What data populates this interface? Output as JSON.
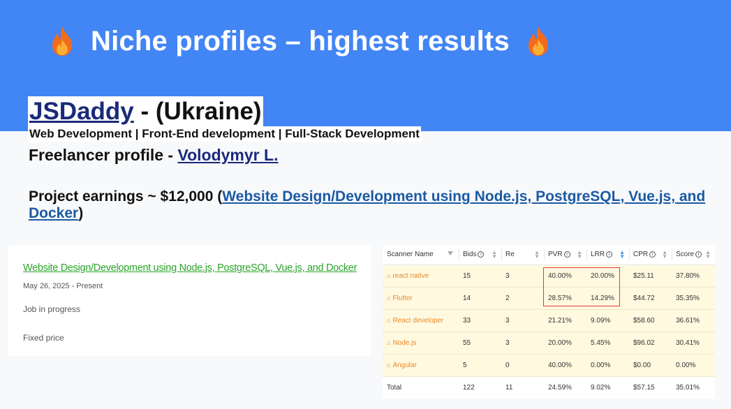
{
  "banner": {
    "title": "Niche profiles – highest results",
    "flame_color": "#f26b1d",
    "background": "#4285f4"
  },
  "agency": {
    "name": "JSDaddy",
    "country": " - (Ukraine)",
    "services": "Web Development | Front-End development | Full-Stack Development"
  },
  "freelancer": {
    "label": "Freelancer profile - ",
    "name": "Volodymyr L."
  },
  "earnings": {
    "prefix": "Project earnings ~ $12,000 (",
    "project_link": "Website Design/Development using Node.js, PostgreSQL, Vue.js, and Docker",
    "suffix": ")"
  },
  "job_card": {
    "title": "Website Design/Development using Node.js, PostgreSQL, Vue.js, and Docker",
    "date": "May 26, 2025 - Present",
    "status": "Job in progress",
    "price_type": "Fixed price"
  },
  "scanner_table": {
    "columns": [
      "Scanner Name",
      "Bids",
      "Re",
      "PVR",
      "LRR",
      "CPR",
      "Score"
    ],
    "rows": [
      {
        "name": "react native",
        "bids": "15",
        "re": "3",
        "pvr": "40.00%",
        "lrr": "20.00%",
        "cpr": "$25.11",
        "score": "37.80%"
      },
      {
        "name": "Flutter",
        "bids": "14",
        "re": "2",
        "pvr": "28.57%",
        "lrr": "14.29%",
        "cpr": "$44.72",
        "score": "35.35%"
      },
      {
        "name": "React developer",
        "bids": "33",
        "re": "3",
        "pvr": "21.21%",
        "lrr": "9.09%",
        "cpr": "$58.60",
        "score": "36.61%"
      },
      {
        "name": "Node.js",
        "bids": "55",
        "re": "3",
        "pvr": "20.00%",
        "lrr": "5.45%",
        "cpr": "$96.02",
        "score": "30.41%"
      },
      {
        "name": "Angular",
        "bids": "5",
        "re": "0",
        "pvr": "40.00%",
        "lrr": "0.00%",
        "cpr": "$0.00",
        "score": "0.00%"
      }
    ],
    "total": {
      "name": "Total",
      "bids": "122",
      "re": "11",
      "pvr": "24.59%",
      "lrr": "9.02%",
      "cpr": "$57.15",
      "score": "35.01%"
    },
    "highlight_color": "#e23b3b",
    "keyword_color": "#e88a2a"
  }
}
